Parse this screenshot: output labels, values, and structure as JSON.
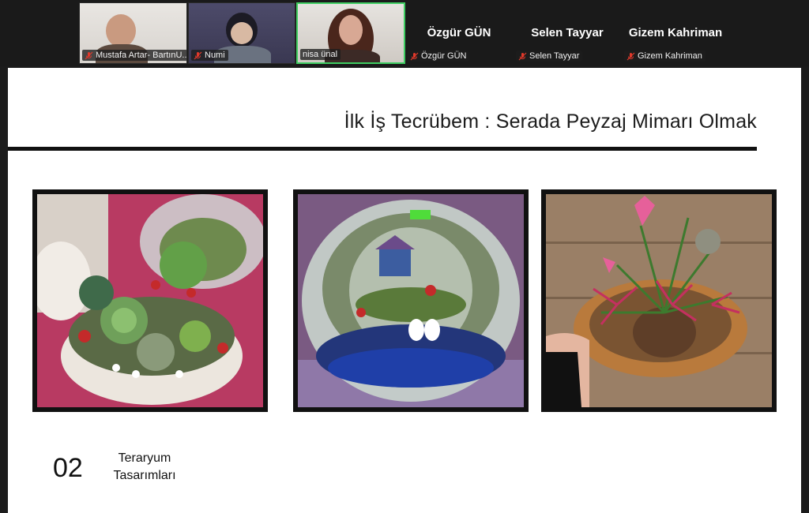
{
  "meeting": {
    "participants": [
      {
        "name": "Mustafa Artar- BartınU...",
        "video": true,
        "active": false,
        "muted": true
      },
      {
        "name": "Numi",
        "video": true,
        "active": false,
        "muted": true
      },
      {
        "name": "nisa ünal",
        "video": true,
        "active": true,
        "muted": false
      },
      {
        "name": "Özgür GÜN",
        "display_name": "Özgür GÜN",
        "video": false,
        "muted": true
      },
      {
        "name": "Selen Tayyar",
        "display_name": "Selen Tayyar",
        "video": false,
        "muted": true
      },
      {
        "name": "Gizem Kahriman",
        "display_name": "Gizem Kahriman",
        "video": false,
        "muted": true
      }
    ]
  },
  "slide": {
    "title": "İlk İş Tecrübem : Serada Peyzaj Mimarı Olmak",
    "section_number": "02",
    "section_title": "Teraryum Tasarımları",
    "photos": [
      "succulent-bowl-terrarium",
      "glass-globe-terrarium",
      "air-plant-arrangement"
    ]
  },
  "colors": {
    "active_speaker": "#3fce62",
    "mute_red": "#e0392b"
  }
}
